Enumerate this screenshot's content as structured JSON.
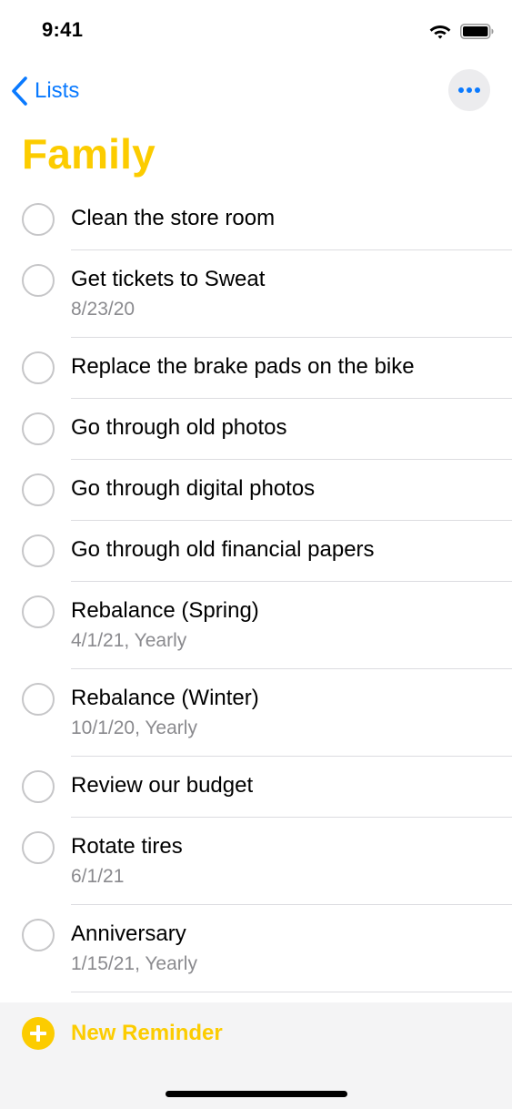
{
  "status_bar": {
    "time": "9:41"
  },
  "nav": {
    "back_label": "Lists"
  },
  "list": {
    "title": "Family",
    "title_color": "#fccc00",
    "items": [
      {
        "title": "Clean the store room",
        "subtitle": ""
      },
      {
        "title": "Get tickets to Sweat",
        "subtitle": "8/23/20"
      },
      {
        "title": "Replace the brake pads on the bike",
        "subtitle": ""
      },
      {
        "title": "Go through old photos",
        "subtitle": ""
      },
      {
        "title": "Go through digital photos",
        "subtitle": ""
      },
      {
        "title": "Go through old financial papers",
        "subtitle": ""
      },
      {
        "title": "Rebalance (Spring)",
        "subtitle": "4/1/21, Yearly"
      },
      {
        "title": "Rebalance (Winter)",
        "subtitle": "10/1/20, Yearly"
      },
      {
        "title": "Review our budget",
        "subtitle": ""
      },
      {
        "title": "Rotate tires",
        "subtitle": "6/1/21"
      },
      {
        "title": "Anniversary",
        "subtitle": "1/15/21, Yearly"
      }
    ]
  },
  "bottom": {
    "new_reminder_label": "New Reminder"
  },
  "icons": {
    "back": "chevron-left-icon",
    "more": "ellipsis-icon",
    "add": "plus-circle-icon",
    "wifi": "wifi-icon",
    "battery": "battery-icon"
  },
  "colors": {
    "accent": "#fccc00",
    "link": "#0a7aff"
  }
}
